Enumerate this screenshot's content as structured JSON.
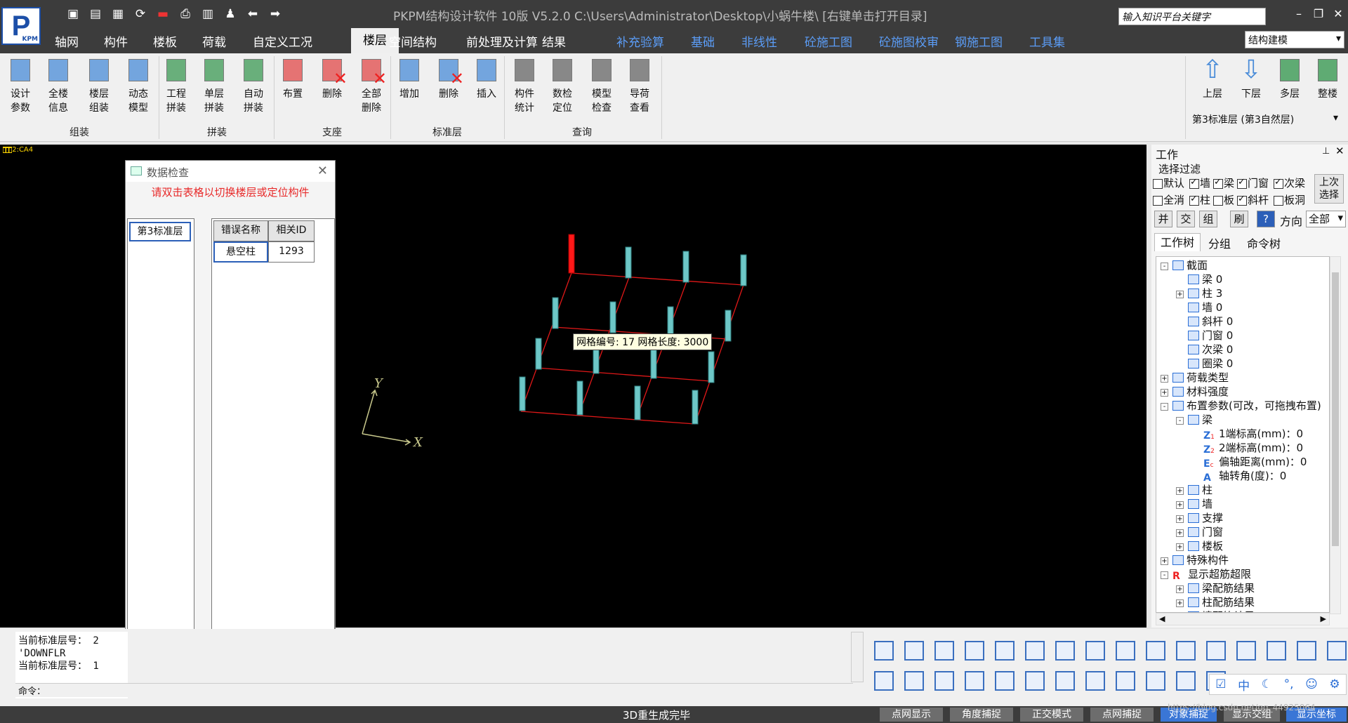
{
  "app": {
    "title": "PKPM结构设计软件 10版 V5.2.0 C:\\Users\\Administrator\\Desktop\\小蜗牛楼\\  [右键单击打开目录]",
    "logo_text": "P",
    "logo_sub": "KPM",
    "search_placeholder": "输入知识平台关键字",
    "mode": "结构建模"
  },
  "menu": {
    "tabs": [
      "轴网",
      "构件",
      "楼板",
      "荷载",
      "自定义工况",
      "楼层",
      "空间结构",
      "前处理及计算",
      "结果",
      "补充验算",
      "基础",
      "非线性",
      "砼施工图",
      "砼施图校审",
      "钢施工图",
      "工具集"
    ],
    "active_tab": "楼层"
  },
  "ribbon": {
    "buttons": [
      {
        "label": "设计\n参数"
      },
      {
        "label": "全楼\n信息"
      },
      {
        "label": "楼层\n组装"
      },
      {
        "label": "动态\n模型"
      },
      {
        "label": "工程\n拼装"
      },
      {
        "label": "单层\n拼装"
      },
      {
        "label": "自动\n拼装"
      },
      {
        "label": "布置"
      },
      {
        "label": "删除"
      },
      {
        "label": "全部\n删除"
      },
      {
        "label": "增加"
      },
      {
        "label": "删除"
      },
      {
        "label": "插入"
      },
      {
        "label": "构件\n统计"
      },
      {
        "label": "数检\n定位"
      },
      {
        "label": "模型\n检查"
      },
      {
        "label": "导荷\n查看"
      }
    ],
    "groups": [
      "组装",
      "拼装",
      "支座",
      "标准层",
      "查询"
    ],
    "right_buttons": [
      {
        "label": "上层"
      },
      {
        "label": "下层"
      },
      {
        "label": "多层"
      },
      {
        "label": "整楼"
      }
    ],
    "story_selector": "第3标准层 (第3自然层)"
  },
  "canvas": {
    "tag": "2:CA4",
    "tooltip": "网格编号: 17  网格长度: 3000",
    "axis_x": "X",
    "axis_y": "Y"
  },
  "dialog": {
    "title": "数据检查",
    "hint": "请双击表格以切换楼层或定位构件",
    "floor_item": "第3标准层",
    "columns": [
      "错误名称",
      "相关ID"
    ],
    "rows": [
      {
        "name": "悬空柱",
        "id": "1293"
      }
    ]
  },
  "panel": {
    "title": "工作",
    "filter_title": "选择过滤",
    "filters_row1": [
      {
        "label": "默认",
        "checked": false
      },
      {
        "label": "墙",
        "checked": true
      },
      {
        "label": "梁",
        "checked": true
      },
      {
        "label": "门窗",
        "checked": true
      },
      {
        "label": "次梁",
        "checked": true
      }
    ],
    "filters_row2": [
      {
        "label": "全消",
        "checked": false
      },
      {
        "label": "柱",
        "checked": true
      },
      {
        "label": "板",
        "checked": false
      },
      {
        "label": "斜杆",
        "checked": true
      },
      {
        "label": "板洞",
        "checked": false
      }
    ],
    "last_select": "上次\n选择",
    "tool_buttons": [
      "并",
      "交",
      "组",
      "刷",
      "?"
    ],
    "direction_label": "方向",
    "direction_value": "全部",
    "tabs": [
      "工作树",
      "分组",
      "命令树"
    ],
    "tree": [
      {
        "label": "截面",
        "depth": 0,
        "exp": "-",
        "icon": "section-icon"
      },
      {
        "label": "梁 0",
        "depth": 1,
        "exp": "",
        "icon": "beam-icon"
      },
      {
        "label": "柱 3",
        "depth": 1,
        "exp": "+",
        "icon": "column-icon"
      },
      {
        "label": "墙 0",
        "depth": 1,
        "exp": "",
        "icon": "wall-icon"
      },
      {
        "label": "斜杆 0",
        "depth": 1,
        "exp": "",
        "icon": "brace-icon"
      },
      {
        "label": "门窗 0",
        "depth": 1,
        "exp": "",
        "icon": "window-icon"
      },
      {
        "label": "次梁 0",
        "depth": 1,
        "exp": "",
        "icon": "secondary-beam-icon"
      },
      {
        "label": "圈梁 0",
        "depth": 1,
        "exp": "",
        "icon": "ring-beam-icon"
      },
      {
        "label": "荷载类型",
        "depth": 0,
        "exp": "+",
        "icon": "load-icon"
      },
      {
        "label": "材料强度",
        "depth": 0,
        "exp": "+",
        "icon": "material-icon"
      },
      {
        "label": "布置参数(可改，可拖拽布置)",
        "depth": 0,
        "exp": "-",
        "icon": "layout-icon"
      },
      {
        "label": "梁",
        "depth": 1,
        "exp": "-",
        "icon": "beam-icon"
      },
      {
        "label": "1端标高(mm)：0",
        "depth": 2,
        "exp": "",
        "icon": "z1-icon",
        "mark": "Z1"
      },
      {
        "label": "2端标高(mm)：0",
        "depth": 2,
        "exp": "",
        "icon": "z2-icon",
        "mark": "Z2"
      },
      {
        "label": "偏轴距离(mm)：0",
        "depth": 2,
        "exp": "",
        "icon": "ec-icon",
        "mark": "Ec"
      },
      {
        "label": "轴转角(度)：0",
        "depth": 2,
        "exp": "",
        "icon": "angle-icon",
        "mark": "A"
      },
      {
        "label": "柱",
        "depth": 1,
        "exp": "+",
        "icon": "column-icon"
      },
      {
        "label": "墙",
        "depth": 1,
        "exp": "+",
        "icon": "wall-icon"
      },
      {
        "label": "支撑",
        "depth": 1,
        "exp": "+",
        "icon": "brace-icon"
      },
      {
        "label": "门窗",
        "depth": 1,
        "exp": "+",
        "icon": "window-icon"
      },
      {
        "label": "楼板",
        "depth": 1,
        "exp": "+",
        "icon": "slab-icon"
      },
      {
        "label": "特殊构件",
        "depth": 0,
        "exp": "+",
        "icon": "special-icon"
      },
      {
        "label": "显示超筋超限",
        "depth": 0,
        "exp": "-",
        "icon": "r-icon",
        "mark": "R"
      },
      {
        "label": "梁配筋结果",
        "depth": 1,
        "exp": "+",
        "icon": "beam-icon"
      },
      {
        "label": "柱配筋结果",
        "depth": 1,
        "exp": "+",
        "icon": "column-icon"
      },
      {
        "label": "墙配筋结果",
        "depth": 1,
        "exp": "+",
        "icon": "wall-icon"
      }
    ]
  },
  "command": {
    "log": [
      "当前标准层号：  2",
      "'DOWNFLR",
      "当前标准层号：  1"
    ],
    "prompt": "命令："
  },
  "status": {
    "message": "3D重生成完毕",
    "buttons": [
      {
        "label": "点网显示",
        "on": false
      },
      {
        "label": "角度捕捉",
        "on": false
      },
      {
        "label": "正交模式",
        "on": false
      },
      {
        "label": "点网捕捉",
        "on": false
      },
      {
        "label": "对象捕捉",
        "on": true
      },
      {
        "label": "显示交组",
        "on": false
      },
      {
        "label": "显示坐标",
        "on": true
      }
    ],
    "watermark": "https://blog.csdn.net/qq_44925064"
  },
  "ime": [
    "中",
    "☾",
    "°,",
    "☺",
    "⚙"
  ]
}
